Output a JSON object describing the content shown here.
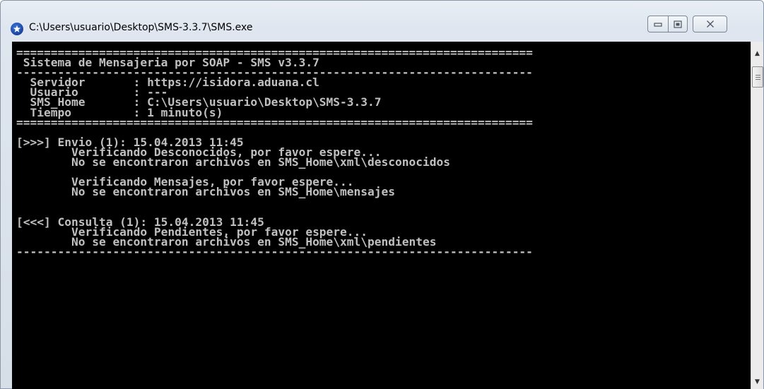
{
  "window": {
    "title": "C:\\Users\\usuario\\Desktop\\SMS-3.3.7\\SMS.exe",
    "controls": {
      "minimize_glyph": "▭",
      "maximize_glyph": "◻",
      "close_glyph": "✕"
    }
  },
  "console": {
    "lines": [
      "===========================================================================",
      " Sistema de Mensajeria por SOAP - SMS v3.3.7",
      "---------------------------------------------------------------------------",
      "  Servidor       : https://isidora.aduana.cl",
      "  Usuario        : ---",
      "  SMS_Home       : C:\\Users\\usuario\\Desktop\\SMS-3.3.7",
      "  Tiempo         : 1 minuto(s)",
      "===========================================================================",
      "",
      "[>>>] Envio (1): 15.04.2013 11:45",
      "        Verificando Desconocidos, por favor espere...",
      "        No se encontraron archivos en SMS_Home\\xml\\desconocidos",
      "",
      "        Verificando Mensajes, por favor espere...",
      "        No se encontraron archivos en SMS_Home\\mensajes",
      "",
      "",
      "[<<<] Consulta (1): 15.04.2013 11:45",
      "        Verificando Pendientes, por favor espere...",
      "        No se encontraron archivos en SMS_Home\\xml\\pendientes",
      "---------------------------------------------------------------------------"
    ]
  },
  "scrollbar": {
    "up_glyph": "▲",
    "down_glyph": "▼"
  },
  "colors": {
    "console_bg": "#000000",
    "console_fg": "#c0c0c0"
  }
}
